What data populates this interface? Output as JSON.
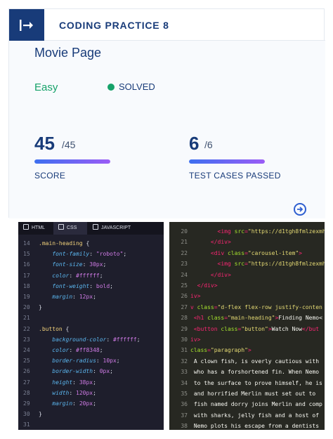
{
  "header": {
    "title": "CODING PRACTICE 8",
    "logo_icon": "exit-arrow-icon"
  },
  "problem": {
    "title": "Movie Page",
    "difficulty": "Easy",
    "status": "SOLVED",
    "score": {
      "value": "45",
      "total": "/45",
      "label": "SCORE",
      "progress": 1.0
    },
    "tests": {
      "value": "6",
      "total": "/6",
      "label": "TEST CASES PASSED",
      "progress": 1.0
    }
  },
  "editor": {
    "tabs": [
      {
        "label": "HTML",
        "icon": "html-file-icon"
      },
      {
        "label": "CSS",
        "icon": "css-file-icon"
      },
      {
        "label": "JAVASCRIPT",
        "icon": "js-file-icon"
      }
    ],
    "css_lines": [
      {
        "n": "14",
        "sel": ".main-heading",
        "p": "",
        "v": "",
        "end": " {"
      },
      {
        "n": "15",
        "sel": "",
        "p": "font-family",
        "v": "\"roboto\"",
        "end": ";"
      },
      {
        "n": "16",
        "sel": "",
        "p": "font-size",
        "v": "30px",
        "end": ";"
      },
      {
        "n": "17",
        "sel": "",
        "p": "color",
        "v": "#ffffff",
        "end": ";"
      },
      {
        "n": "18",
        "sel": "",
        "p": "font-weight",
        "v": "bold",
        "end": ";"
      },
      {
        "n": "19",
        "sel": "",
        "p": "margin",
        "v": "12px",
        "end": ";"
      },
      {
        "n": "20",
        "sel": "",
        "p": "",
        "v": "",
        "end": "}"
      },
      {
        "n": "21",
        "sel": "",
        "p": "",
        "v": "",
        "end": ""
      },
      {
        "n": "22",
        "sel": ".button",
        "p": "",
        "v": "",
        "end": " {"
      },
      {
        "n": "23",
        "sel": "",
        "p": "background-color",
        "v": "#ffffff",
        "end": ";"
      },
      {
        "n": "24",
        "sel": "",
        "p": "color",
        "v": "#ff8348",
        "end": ";"
      },
      {
        "n": "25",
        "sel": "",
        "p": "border-radius",
        "v": "10px",
        "end": ";"
      },
      {
        "n": "26",
        "sel": "",
        "p": "border-width",
        "v": "0px",
        "end": ";"
      },
      {
        "n": "27",
        "sel": "",
        "p": "height",
        "v": "38px",
        "end": ";"
      },
      {
        "n": "28",
        "sel": "",
        "p": "width",
        "v": "120px",
        "end": ";"
      },
      {
        "n": "29",
        "sel": "",
        "p": "margin",
        "v": "20px",
        "end": ";"
      },
      {
        "n": "30",
        "sel": "",
        "p": "",
        "v": "",
        "end": "}"
      },
      {
        "n": "31",
        "sel": "",
        "p": "",
        "v": "",
        "end": ""
      }
    ],
    "html_lines": [
      {
        "n": "20",
        "parts": [
          [
            "t",
            "        <img "
          ],
          [
            "a",
            "src"
          ],
          [
            "t",
            "="
          ],
          [
            "s",
            "\"https://d1tgh8fmlzexmh"
          ]
        ]
      },
      {
        "n": "21",
        "parts": [
          [
            "t",
            "      </div>"
          ]
        ]
      },
      {
        "n": "22",
        "parts": [
          [
            "t",
            "      <div "
          ],
          [
            "a",
            "class"
          ],
          [
            "t",
            "="
          ],
          [
            "s",
            "\"carousel-item\""
          ],
          [
            "t",
            ">"
          ]
        ]
      },
      {
        "n": "23",
        "parts": [
          [
            "t",
            "        <img "
          ],
          [
            "a",
            "src"
          ],
          [
            "t",
            "="
          ],
          [
            "s",
            "\"https://d1tgh8fmlzexmh"
          ]
        ]
      },
      {
        "n": "24",
        "parts": [
          [
            "t",
            "      </div>"
          ]
        ]
      },
      {
        "n": "25",
        "parts": [
          [
            "t",
            "  </div>"
          ]
        ]
      },
      {
        "n": "26",
        "parts": [
          [
            "t",
            "iv>"
          ]
        ]
      },
      {
        "n": "27",
        "parts": [
          [
            "t",
            "v "
          ],
          [
            "a",
            "class"
          ],
          [
            "t",
            "="
          ],
          [
            "s",
            "\"d-flex flex-row justify-conten"
          ]
        ]
      },
      {
        "n": "28",
        "parts": [
          [
            "t",
            " <h1 "
          ],
          [
            "a",
            "class"
          ],
          [
            "t",
            "="
          ],
          [
            "s",
            "\"main-heading\""
          ],
          [
            "t",
            ">"
          ],
          [
            "x",
            "Finding Nemo<"
          ]
        ]
      },
      {
        "n": "29",
        "parts": [
          [
            "t",
            " <button "
          ],
          [
            "a",
            "class"
          ],
          [
            "t",
            "="
          ],
          [
            "s",
            "\"button\""
          ],
          [
            "t",
            ">"
          ],
          [
            "x",
            "Watch Now"
          ],
          [
            "t",
            "</but"
          ]
        ]
      },
      {
        "n": "30",
        "parts": [
          [
            "t",
            "iv>"
          ]
        ]
      },
      {
        "n": "31",
        "parts": [
          [
            "a",
            "class"
          ],
          [
            "t",
            "="
          ],
          [
            "s",
            "\"paragraph\""
          ],
          [
            "t",
            ">"
          ]
        ]
      },
      {
        "n": "32",
        "parts": [
          [
            "x",
            " A clown fish, is overly cautious with"
          ]
        ]
      },
      {
        "n": "33",
        "parts": [
          [
            "x",
            " who has a forshortened fin. When Nemo"
          ]
        ]
      },
      {
        "n": "34",
        "parts": [
          [
            "x",
            " to the surface to prove himself, he is"
          ]
        ]
      },
      {
        "n": "35",
        "parts": [
          [
            "x",
            " and horrified Merlin must set out to"
          ]
        ]
      },
      {
        "n": "36",
        "parts": [
          [
            "x",
            " fish named dorry joins Merlin and comp"
          ]
        ]
      },
      {
        "n": "37",
        "parts": [
          [
            "x",
            " with sharks, jelly fish and a host of"
          ]
        ]
      },
      {
        "n": "38",
        "parts": [
          [
            "x",
            " Nemo plots his escape from a dentists"
          ]
        ]
      }
    ]
  },
  "colors": {
    "brand": "#183b79",
    "success": "#16a26a",
    "progress_start": "#3d6ff0",
    "progress_end": "#9b5cf6"
  }
}
